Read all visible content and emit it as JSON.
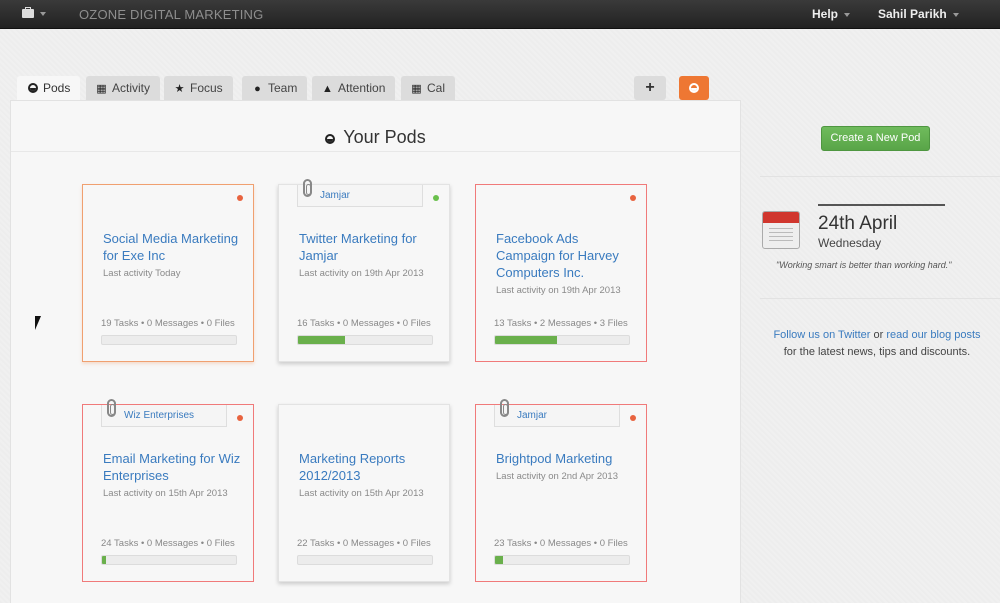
{
  "topbar": {
    "app_title": "OZONE DIGITAL MARKETING",
    "help_label": "Help",
    "user_name": "Sahil Parikh"
  },
  "tabs": [
    {
      "label": "Pods",
      "icon": "pod-icon"
    },
    {
      "label": "Activity",
      "icon": "film-icon"
    },
    {
      "label": "Focus",
      "icon": "star-icon"
    },
    {
      "label": "Team",
      "icon": "person-icon"
    },
    {
      "label": "Attention",
      "icon": "bell-icon"
    },
    {
      "label": "Cal",
      "icon": "calendar-icon"
    }
  ],
  "toolbar": {
    "add_label": "+"
  },
  "main": {
    "title": "Your Pods"
  },
  "pods": [
    {
      "name": "Social Media Marketing for Exe Inc",
      "activity": "Last activity Today",
      "stats": "19 Tasks • 0 Messages • 0 Files",
      "tag": "",
      "progress": 0,
      "dot_color": "#e8633f"
    },
    {
      "name": "Twitter Marketing for Jamjar",
      "activity": "Last activity on 19th Apr 2013",
      "stats": "16 Tasks • 0 Messages • 0 Files",
      "tag": "Jamjar",
      "progress": 0.35,
      "dot_color": "#6ac04c"
    },
    {
      "name": "Facebook Ads Campaign for Harvey Computers Inc.",
      "activity": "Last activity on 19th Apr 2013",
      "stats": "13 Tasks • 2 Messages • 3 Files",
      "tag": "",
      "progress": 0.46,
      "dot_color": "#e8633f"
    },
    {
      "name": "Email Marketing for Wiz Enterprises",
      "activity": "Last activity on 15th Apr 2013",
      "stats": "24 Tasks • 0 Messages • 0 Files",
      "tag": "Wiz Enterprises",
      "progress": 0.03,
      "dot_color": "#e8633f"
    },
    {
      "name": "Marketing Reports 2012/2013",
      "activity": "Last activity on 15th Apr 2013",
      "stats": "22 Tasks • 0 Messages • 0 Files",
      "tag": "",
      "progress": 0,
      "dot_color": ""
    },
    {
      "name": "Brightpod Marketing",
      "activity": "Last activity on 2nd Apr 2013",
      "stats": "23 Tasks • 0 Messages • 0 Files",
      "tag": "Jamjar",
      "progress": 0.06,
      "dot_color": "#e8633f"
    }
  ],
  "sidebar": {
    "create_label": "Create a New Pod",
    "date": "24th April",
    "day": "Wednesday",
    "quote": "\"Working smart is better than working hard.\"",
    "follow_twitter": "Follow us on Twitter",
    "follow_or": "or",
    "follow_blog": "read our blog posts",
    "follow_tail": "for the latest news, tips and discounts."
  },
  "colors": {
    "accent_orange": "#ee7733",
    "link_blue": "#3a7bbf",
    "progress_green": "#6ab04c",
    "alert_red": "#f07a7a"
  }
}
